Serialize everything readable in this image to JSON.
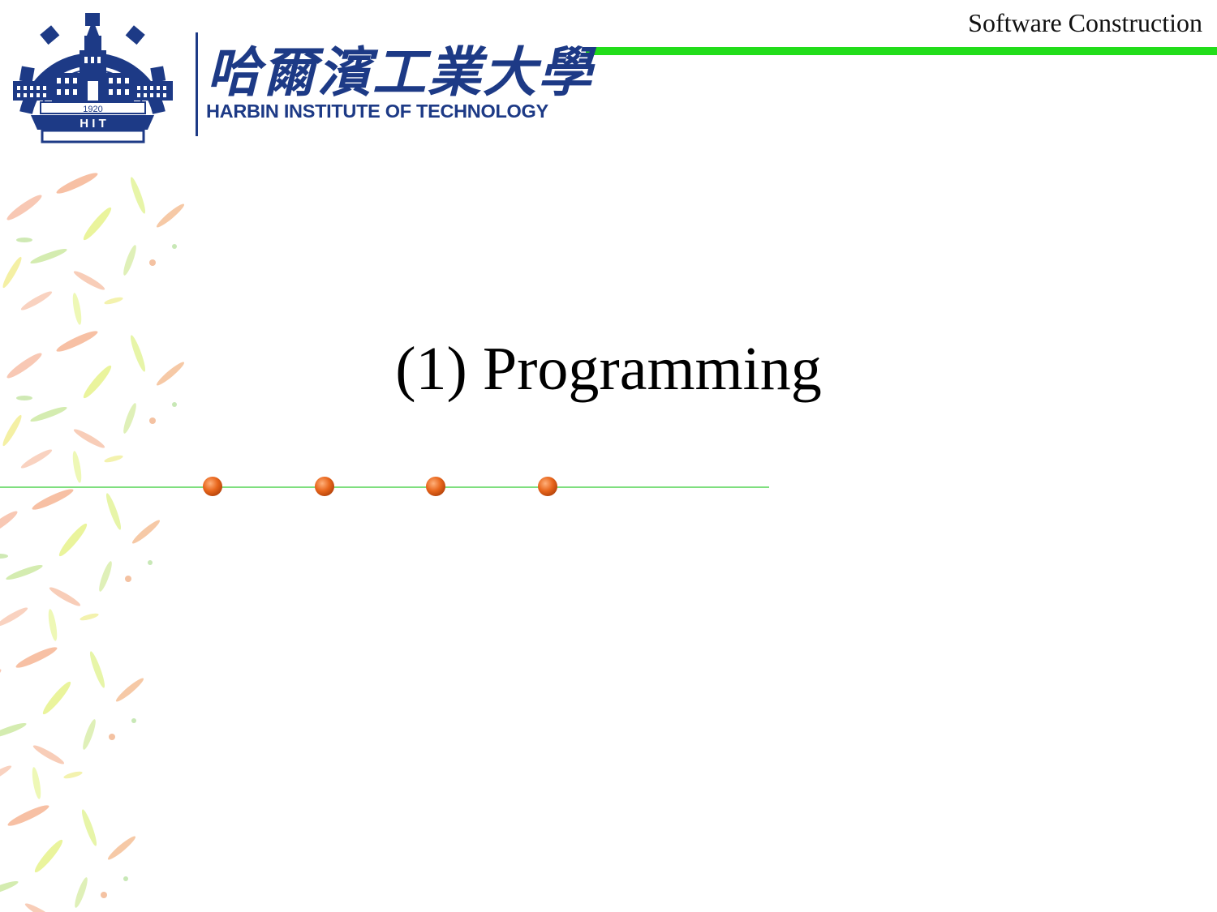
{
  "header": {
    "course_label": "Software Construction",
    "accent_color": "#22dd1a"
  },
  "logo": {
    "university_cn": "哈爾濱工業大學",
    "university_en": "HARBIN INSTITUTE OF TECHNOLOGY",
    "seal_year": "1920",
    "seal_initials": "H I T",
    "brand_color": "#1d3a86"
  },
  "slide": {
    "title": "(1) Programming"
  },
  "timeline": {
    "dot_count": 4,
    "dot_color": "#e8661c",
    "line_color": "#33cc33"
  }
}
